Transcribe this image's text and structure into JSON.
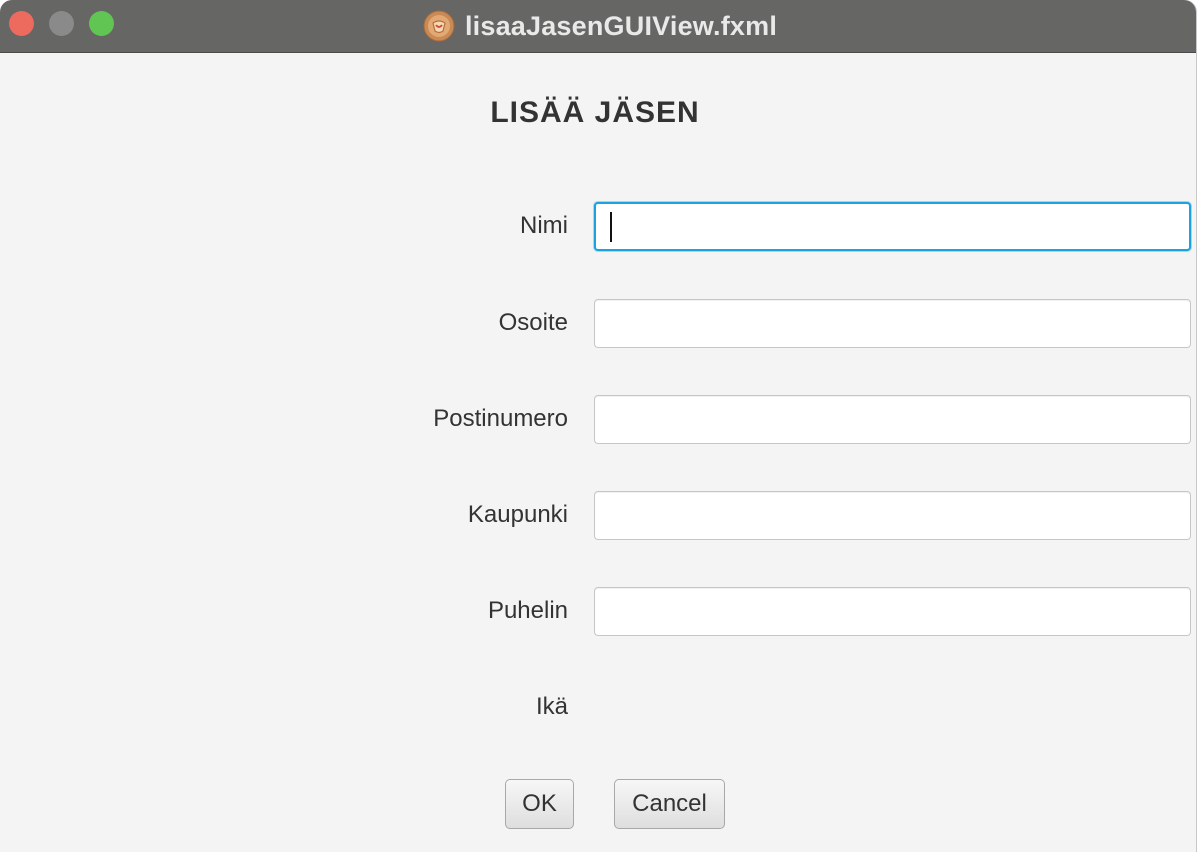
{
  "window": {
    "title": "lisaaJasenGUIView.fxml",
    "icon": "java-app-icon",
    "controls": {
      "close": "close-icon",
      "minimize": "minimize-icon",
      "maximize": "maximize-icon"
    }
  },
  "form": {
    "heading": "LISÄÄ JÄSEN",
    "fields": [
      {
        "label": "Nimi",
        "value": "",
        "focused": true
      },
      {
        "label": "Osoite",
        "value": ""
      },
      {
        "label": "Postinumero",
        "value": ""
      },
      {
        "label": "Kaupunki",
        "value": ""
      },
      {
        "label": "Puhelin",
        "value": ""
      }
    ],
    "age_label": "Ikä"
  },
  "buttons": {
    "ok": "OK",
    "cancel": "Cancel"
  },
  "colors": {
    "titlebar": "#666664",
    "background": "#f4f4f4",
    "focus_ring": "#1aa3df",
    "close": "#ec6a5e",
    "minimize": "#8a8a8a",
    "maximize": "#61c554"
  }
}
